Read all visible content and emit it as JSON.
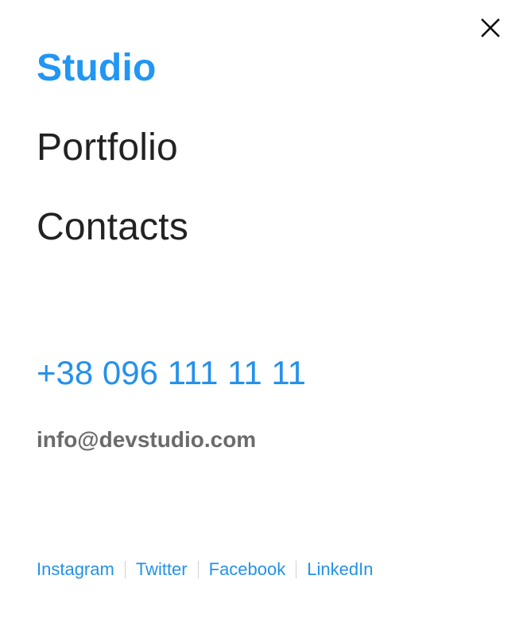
{
  "menu": {
    "close_icon": "close-icon",
    "items": [
      {
        "label": "Studio",
        "active": true
      },
      {
        "label": "Portfolio",
        "active": false
      },
      {
        "label": "Contacts",
        "active": false
      }
    ]
  },
  "contacts": {
    "phone": "+38 096 111 11 11",
    "email": "info@devstudio.com"
  },
  "social": [
    {
      "label": "Instagram"
    },
    {
      "label": "Twitter"
    },
    {
      "label": "Facebook"
    },
    {
      "label": "LinkedIn"
    }
  ],
  "colors": {
    "accent": "#2196f3",
    "text_dark": "#222222",
    "text_muted": "#6b6b6b",
    "separator": "#cfcfcf",
    "background": "#ffffff"
  }
}
